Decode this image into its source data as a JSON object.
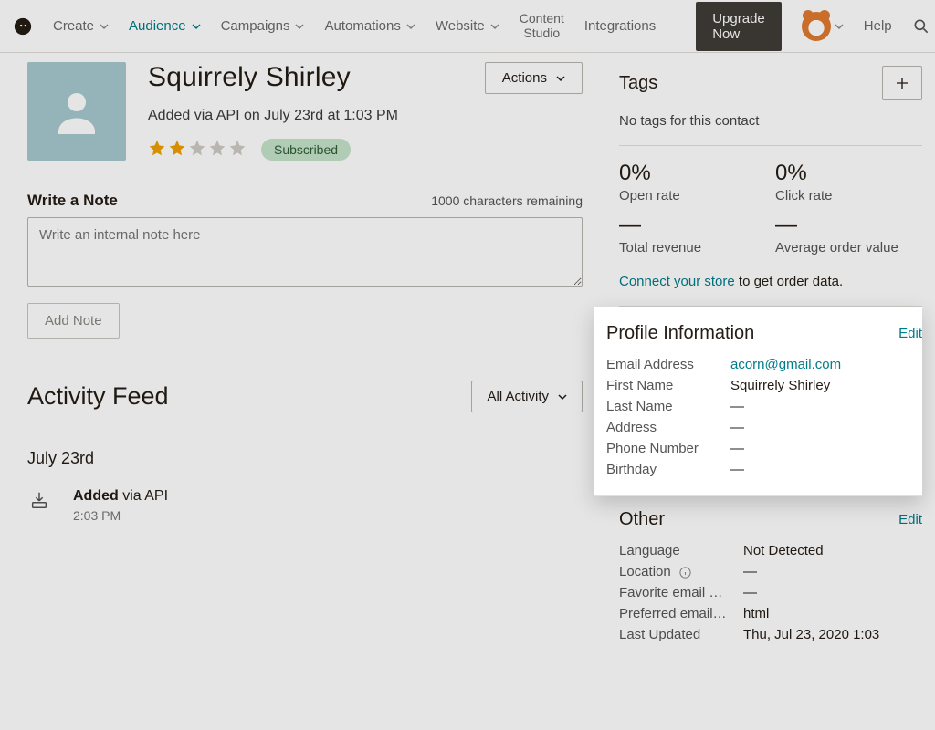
{
  "nav": {
    "create": "Create",
    "audience": "Audience",
    "campaigns": "Campaigns",
    "automations": "Automations",
    "website": "Website",
    "content_studio_l1": "Content",
    "content_studio_l2": "Studio",
    "integrations": "Integrations",
    "upgrade": "Upgrade Now",
    "help": "Help"
  },
  "contact": {
    "name": "Squirrely Shirley",
    "added_line": "Added via API on July 23rd at 1:03 PM",
    "status_badge": "Subscribed",
    "actions_label": "Actions"
  },
  "note": {
    "heading": "Write a Note",
    "remaining": "1000 characters remaining",
    "placeholder": "Write an internal note here",
    "add_btn": "Add Note"
  },
  "feed": {
    "heading": "Activity Feed",
    "filter": "All Activity",
    "date": "July 23rd",
    "items": [
      {
        "bold": "Added",
        "rest": " via API",
        "time": "2:03 PM"
      }
    ]
  },
  "tags": {
    "heading": "Tags",
    "empty": "No tags for this contact"
  },
  "stats": {
    "open_val": "0%",
    "open_lbl": "Open rate",
    "click_val": "0%",
    "click_lbl": "Click rate",
    "rev_val": "—",
    "rev_lbl": "Total revenue",
    "aov_val": "—",
    "aov_lbl": "Average order value",
    "store_link": "Connect your store",
    "store_rest": " to get order data."
  },
  "profile": {
    "heading": "Profile Information",
    "edit": "Edit",
    "rows": {
      "email_k": "Email Address",
      "email_v": "acorn@gmail.com",
      "first_k": "First Name",
      "first_v": "Squirrely Shirley",
      "last_k": "Last Name",
      "last_v": "—",
      "addr_k": "Address",
      "addr_v": "—",
      "phone_k": "Phone Number",
      "phone_v": "—",
      "bday_k": "Birthday",
      "bday_v": "—"
    }
  },
  "other": {
    "heading": "Other",
    "edit": "Edit",
    "rows": {
      "lang_k": "Language",
      "lang_v": "Not Detected",
      "loc_k": "Location",
      "loc_v": "—",
      "fav_k": "Favorite email …",
      "fav_v": "—",
      "pref_k": "Preferred email…",
      "pref_v": "html",
      "upd_k": "Last Updated",
      "upd_v": "Thu, Jul 23, 2020 1:03"
    }
  }
}
